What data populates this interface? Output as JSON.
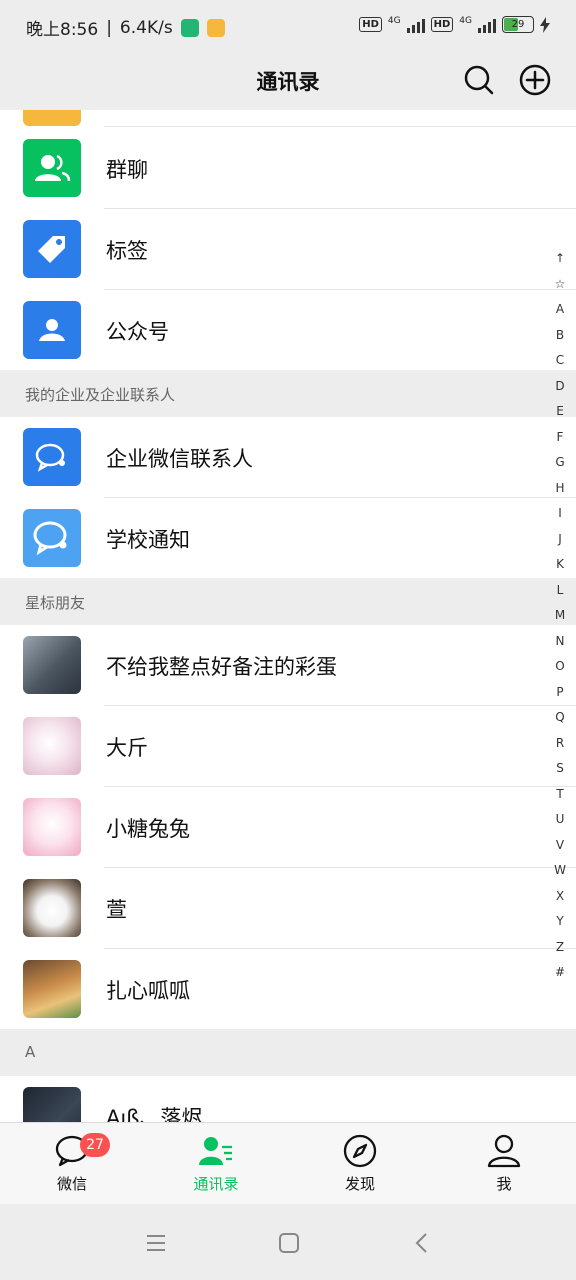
{
  "status": {
    "time": "晚上8:56",
    "speed": "6.4K/s",
    "hd1": "HD",
    "net1": "4G",
    "hd2": "HD",
    "net2": "4G",
    "battery": "29"
  },
  "header": {
    "title": "通讯录",
    "search_icon": "search-icon",
    "add_icon": "plus-circle-icon"
  },
  "top_rows": [
    {
      "label": "群聊",
      "icon": "group-icon",
      "color": "#07c160"
    },
    {
      "label": "标签",
      "icon": "tag-icon",
      "color": "#2b7de9"
    },
    {
      "label": "公众号",
      "icon": "official-account-icon",
      "color": "#2b7de9"
    }
  ],
  "section_enterprise": "我的企业及企业联系人",
  "enterprise_rows": [
    {
      "label": "企业微信联系人",
      "icon": "wecom-icon",
      "color": "#2b7de9"
    },
    {
      "label": "学校通知",
      "icon": "school-notice-icon",
      "color": "#4da3f2"
    }
  ],
  "section_starred": "星标朋友",
  "starred_rows": [
    {
      "label": "不给我整点好备注的彩蛋"
    },
    {
      "label": "大斤"
    },
    {
      "label": "小糖兔兔"
    },
    {
      "label": "萱"
    },
    {
      "label": "扎心呱呱"
    }
  ],
  "section_a": "A",
  "a_rows": [
    {
      "label": "Aıß、落烬"
    }
  ],
  "index_letters": [
    "↑",
    "☆",
    "A",
    "B",
    "C",
    "D",
    "E",
    "F",
    "G",
    "H",
    "I",
    "J",
    "K",
    "L",
    "M",
    "N",
    "O",
    "P",
    "Q",
    "R",
    "S",
    "T",
    "U",
    "V",
    "W",
    "X",
    "Y",
    "Z",
    "#"
  ],
  "tabs": [
    {
      "label": "微信",
      "icon": "chat-bubble-icon",
      "badge": "27"
    },
    {
      "label": "通讯录",
      "icon": "contacts-icon",
      "active": true
    },
    {
      "label": "发现",
      "icon": "compass-icon"
    },
    {
      "label": "我",
      "icon": "person-icon"
    }
  ],
  "accent": "#07c160"
}
